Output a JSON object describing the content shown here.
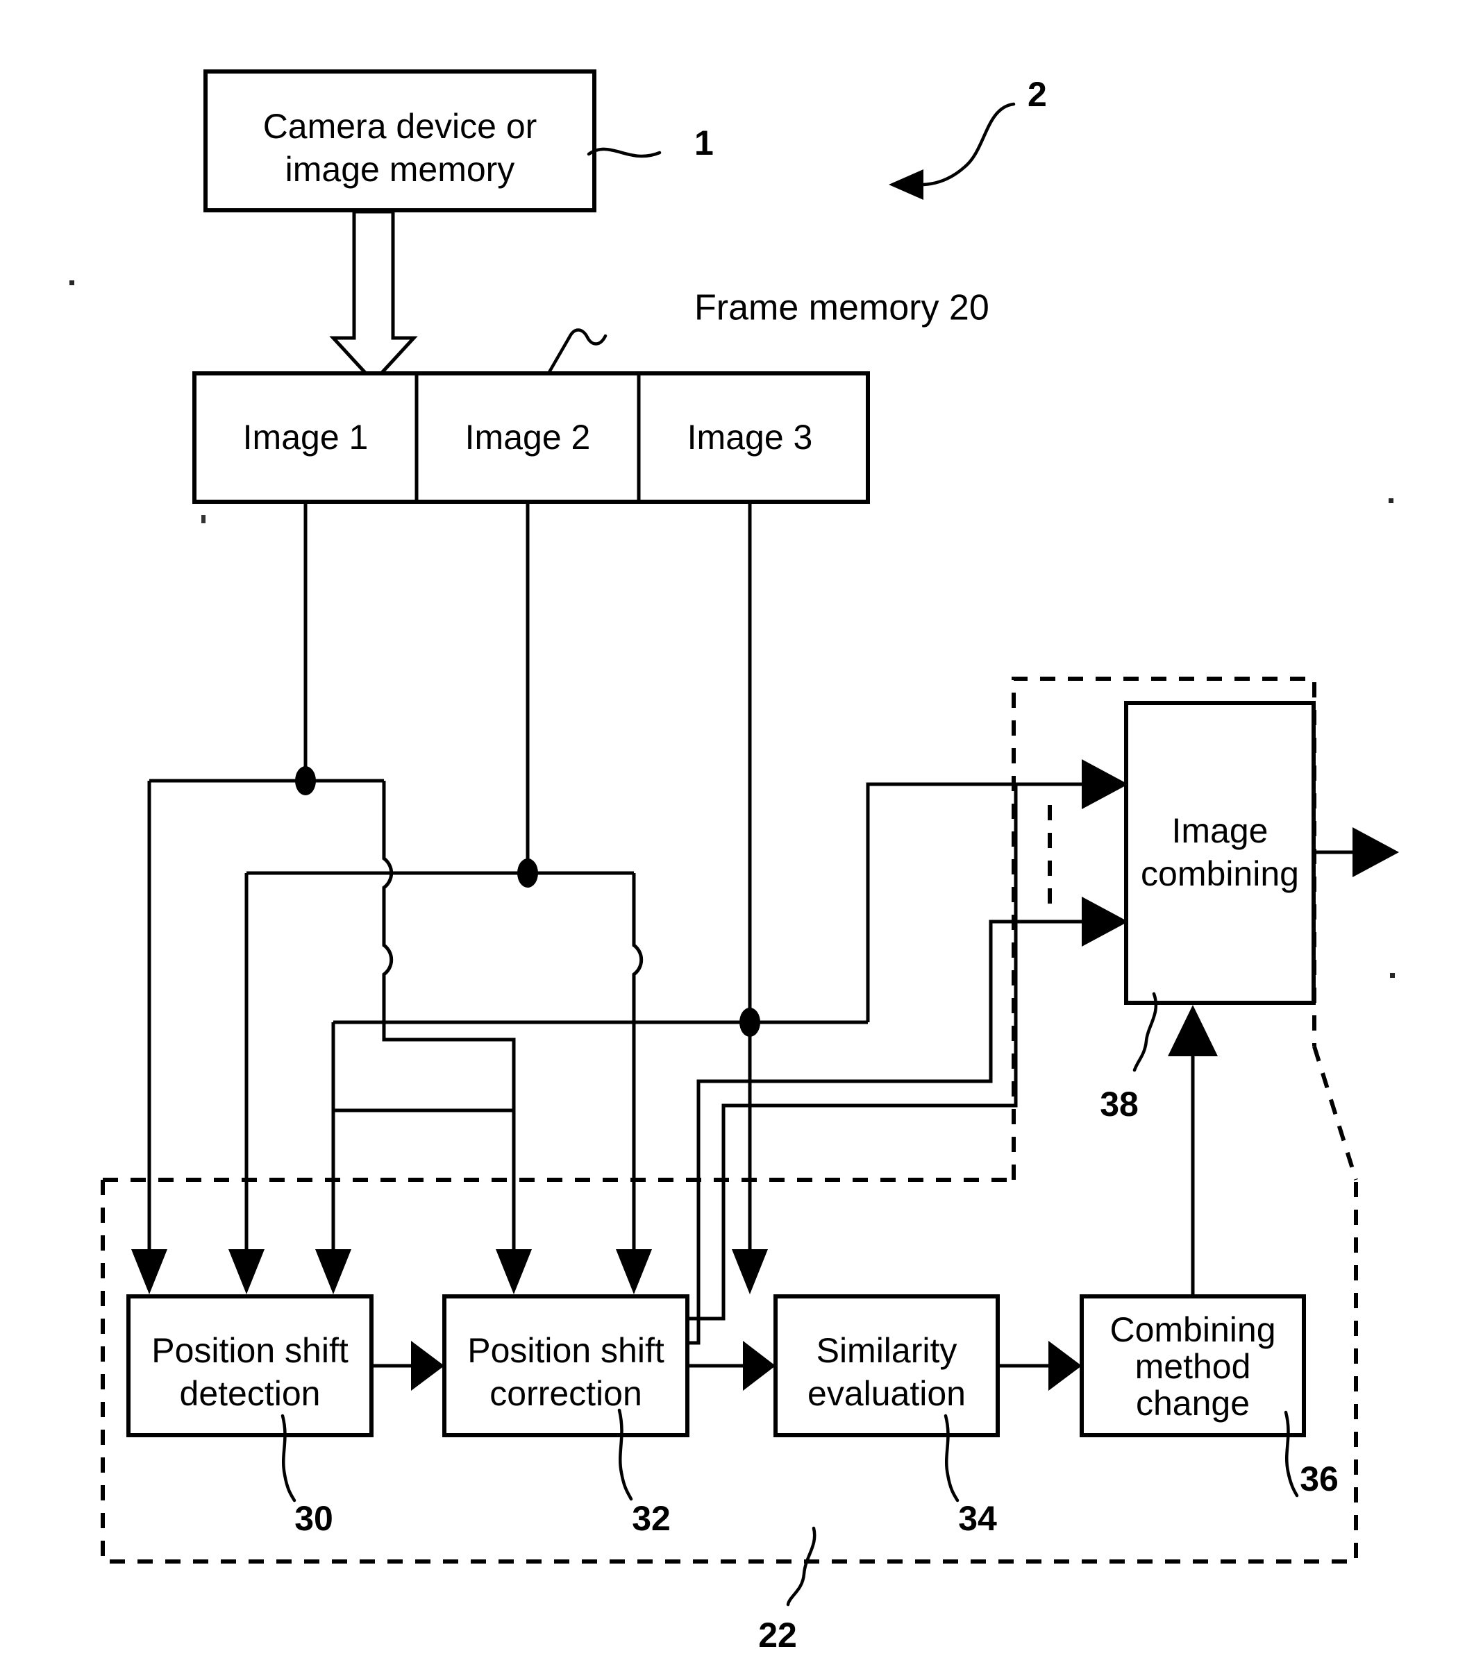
{
  "figure": {
    "kind": "patent-block-diagram",
    "background_color": "#ffffff",
    "line_color": "#000000"
  },
  "blocks": {
    "source": {
      "line1": "Camera device or",
      "line2": "image memory",
      "ref": "1"
    },
    "frame_memory": {
      "caption": "Frame memory 20",
      "cells": [
        {
          "label": "Image 1"
        },
        {
          "label": "Image 2"
        },
        {
          "label": "Image 3"
        }
      ]
    },
    "image_combining": {
      "line1": "Image",
      "line2": "combining",
      "ref": "38"
    },
    "position_shift_detection": {
      "line1": "Position shift",
      "line2": "detection",
      "ref": "30"
    },
    "position_shift_correction": {
      "line1": "Position shift",
      "line2": "correction",
      "ref": "32"
    },
    "similarity_evaluation": {
      "line1": "Similarity",
      "line2": "evaluation",
      "ref": "34"
    },
    "combining_method_change": {
      "line1": "Combining",
      "line2": "method",
      "line3": "change",
      "ref": "36"
    }
  },
  "reference_numerals": {
    "system": "2",
    "source": "1",
    "frame_memory": "20",
    "processing_unit": "22",
    "detection": "30",
    "correction": "32",
    "similarity": "34",
    "method_change": "36",
    "combining": "38"
  }
}
